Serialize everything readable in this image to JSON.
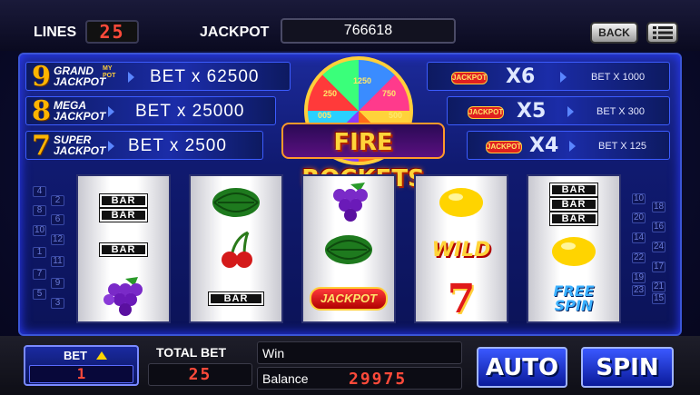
{
  "topbar": {
    "lines_label": "LINES",
    "lines_value": "25",
    "jackpot_label": "JACKPOT",
    "jackpot_value": "766618",
    "back_label": "BACK"
  },
  "jackpots_left": [
    {
      "num": "9",
      "name_line1": "GRAND",
      "name_line2": "JACKPOT",
      "badge": "MY POT",
      "bet": "BET x 62500"
    },
    {
      "num": "8",
      "name_line1": "MEGA",
      "name_line2": "JACKPOT",
      "bet": "BET x 25000"
    },
    {
      "num": "7",
      "name_line1": "SUPER",
      "name_line2": "JACKPOT",
      "bet": "BET x 2500"
    }
  ],
  "jackpots_right": [
    {
      "mult": "X6",
      "bet": "BET X 1000",
      "icon": "JACKPOT"
    },
    {
      "mult": "X5",
      "bet": "BET X 300",
      "icon": "JACKPOT"
    },
    {
      "mult": "X4",
      "bet": "BET X 125",
      "icon": "JACKPOT"
    }
  ],
  "logo": {
    "title": "FIRE ROCKETS",
    "wheel_values": [
      "250",
      "1250",
      "750",
      "500",
      "005"
    ]
  },
  "reels": [
    [
      "BAR",
      "BAR",
      "BAR",
      "grape"
    ],
    [
      "watermelon",
      "cherry",
      "BAR"
    ],
    [
      "grape",
      "watermelon",
      "JACKPOT"
    ],
    [
      "lemon",
      "WILD",
      "7"
    ],
    [
      "BAR",
      "BAR",
      "BAR",
      "lemon",
      "FREE SPIN"
    ]
  ],
  "paylines_left": [
    "4",
    "2",
    "8",
    "6",
    "10",
    "12",
    "1",
    "11",
    "7",
    "9",
    "5",
    "3"
  ],
  "paylines_right": [
    "10",
    "18",
    "20",
    "16",
    "14",
    "24",
    "22",
    "17",
    "19",
    "21",
    "23",
    "15"
  ],
  "bottom": {
    "bet_label": "BET",
    "bet_value": "1",
    "total_bet_label": "TOTAL BET",
    "total_bet_value": "25",
    "win_label": "Win",
    "balance_label": "Balance",
    "balance_value": "29975",
    "auto_label": "AUTO",
    "spin_label": "SPIN"
  },
  "colors": {
    "lcd_red": "#ff4a3a",
    "frame_blue": "#1c2a9a",
    "accent_gold": "#ffb400"
  }
}
